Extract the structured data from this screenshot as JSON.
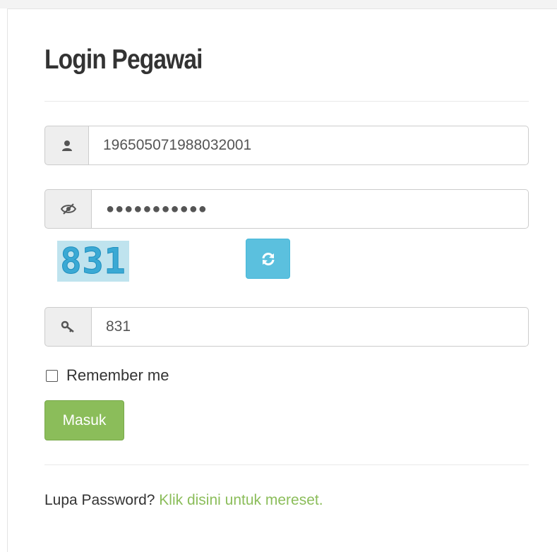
{
  "page": {
    "title": "Login Pegawai"
  },
  "form": {
    "username_value": "196505071988032001",
    "password_value": "●●●●●●●●●●●",
    "captcha_text": "831",
    "captcha_value": "831",
    "remember_label": "Remember me",
    "submit_label": "Masuk"
  },
  "footer": {
    "forgot_prefix": "Lupa Password?",
    "forgot_link": "Klik disini untuk mereset."
  },
  "colors": {
    "primary_green": "#8bbd5a",
    "info_blue": "#5bc0de",
    "addon_bg": "#eeeeee"
  },
  "icons": {
    "user": "user-icon",
    "password": "eye-slash-icon",
    "captcha_refresh": "refresh-icon",
    "captcha_key": "key-icon"
  }
}
